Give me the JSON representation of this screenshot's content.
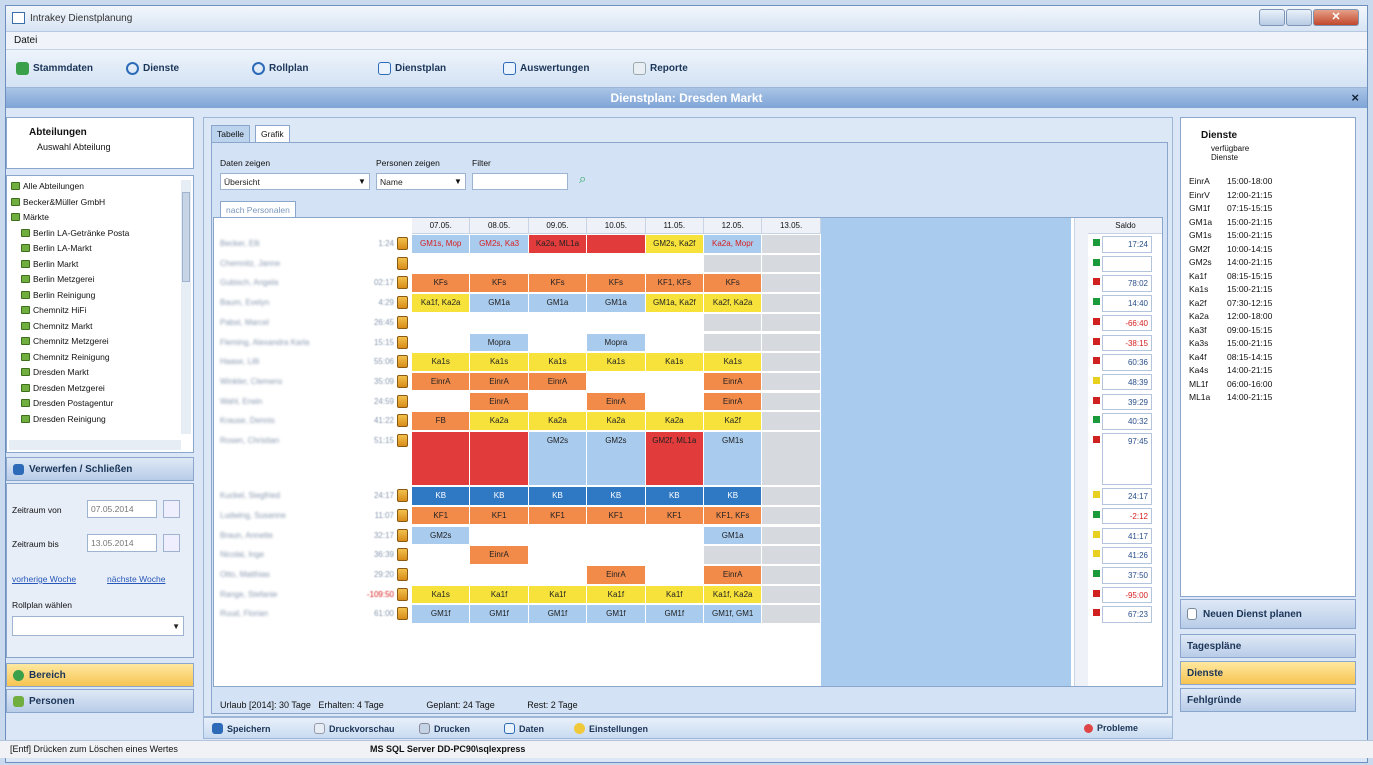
{
  "window": {
    "title": "Intrakey Dienstplanung"
  },
  "menu": {
    "file": "Datei"
  },
  "toolbar": {
    "stammdaten": "Stammdaten",
    "dienste": "Dienste",
    "rollplan": "Rollplan",
    "dienstplan": "Dienstplan",
    "auswertungen": "Auswertungen",
    "reporte": "Reporte"
  },
  "banner": {
    "title": "Dienstplan: Dresden Markt",
    "close": "×"
  },
  "left": {
    "abteilungen": "Abteilungen",
    "auswahl": "Auswahl Abteilung",
    "tree": [
      "Alle Abteilungen",
      "Becker&Müller GmbH",
      "Märkte",
      "Berlin LA-Getränke Posta",
      "Berlin LA-Markt",
      "Berlin Markt",
      "Berlin Metzgerei",
      "Berlin Reinigung",
      "Chemnitz HiFi",
      "Chemnitz Markt",
      "Chemnitz Metzgerei",
      "Chemnitz Reinigung",
      "Dresden Markt",
      "Dresden Metzgerei",
      "Dresden Postagentur",
      "Dresden Reinigung"
    ],
    "verwerfen": "Verwerfen / Schließen",
    "von_label": "Zeitraum von",
    "von_value": "07.05.2014",
    "bis_label": "Zeitraum bis",
    "bis_value": "13.05.2014",
    "prev_week": "vorherige Woche",
    "next_week": "nächste Woche",
    "rollplan_label": "Rollplan wählen",
    "bereich": "Bereich",
    "personen": "Personen"
  },
  "center": {
    "tab_tabelle": "Tabelle",
    "tab_grafik": "Grafik",
    "daten_label": "Daten zeigen",
    "daten_value": "Übersicht",
    "personen_label": "Personen zeigen",
    "personen_value": "Name",
    "filter_label": "Filter",
    "subtab": "nach Personalen",
    "dates": [
      "07.05.",
      "08.05.",
      "09.05.",
      "10.05.",
      "11.05.",
      "12.05.",
      "13.05."
    ],
    "saldo_header": "Saldo",
    "rows": [
      {
        "name": "Becker, Elli",
        "hours": "1:24",
        "cells": [
          [
            "GM1s, Mop",
            "r"
          ],
          [
            "GM2s, Ka3",
            "r"
          ],
          [
            "Ka2a, ML1a",
            "red"
          ],
          [
            "",
            "red"
          ],
          [
            "GM2s, Ka2f",
            "y"
          ],
          [
            "Ka2a, Mopr",
            "r"
          ]
        ],
        "saldo": "17:24",
        "sq": "#1a9a3a"
      },
      {
        "name": "Chemnitz, Janne",
        "hours": "",
        "cells": [
          [
            "",
            "w"
          ],
          [
            "",
            "w"
          ],
          [
            "",
            "w"
          ],
          [
            "",
            "w"
          ],
          [
            "",
            "w"
          ],
          [
            "",
            "g"
          ]
        ],
        "saldo": "",
        "sq": "#1a9a3a"
      },
      {
        "name": "Gubisch, Angela",
        "hours": "02:17",
        "cells": [
          [
            "KFs",
            "o"
          ],
          [
            "KFs",
            "o"
          ],
          [
            "KFs",
            "o"
          ],
          [
            "KFs",
            "o"
          ],
          [
            "KF1, KFs",
            "o"
          ],
          [
            "KFs",
            "o"
          ]
        ],
        "saldo": "78:02",
        "sq": "#d02020"
      },
      {
        "name": "Baum, Evelyn",
        "hours": "4:29",
        "cells": [
          [
            "Ka1f, Ka2a",
            "y"
          ],
          [
            "GM1a",
            "b"
          ],
          [
            "GM1a",
            "b"
          ],
          [
            "GM1a",
            "b"
          ],
          [
            "GM1a, Ka2f",
            "y"
          ],
          [
            "Ka2f, Ka2a",
            "y"
          ]
        ],
        "saldo": "14:40",
        "sq": "#1a9a3a"
      },
      {
        "name": "Pabst, Marcel",
        "hours": "26:45",
        "cells": [
          [
            "",
            "w"
          ],
          [
            "",
            "w"
          ],
          [
            "",
            "w"
          ],
          [
            "",
            "w"
          ],
          [
            "",
            "w"
          ],
          [
            "",
            "g"
          ]
        ],
        "saldo": "-66:40",
        "sq": "#d02020"
      },
      {
        "name": "Fleming, Alexandra Karla",
        "hours": "15:15",
        "cells": [
          [
            "",
            "w"
          ],
          [
            "Mopra",
            "b"
          ],
          [
            "",
            "w"
          ],
          [
            "Mopra",
            "b"
          ],
          [
            "",
            "w"
          ],
          [
            "",
            "g"
          ]
        ],
        "saldo": "-38:15",
        "sq": "#d02020"
      },
      {
        "name": "Haase, Lilli",
        "hours": "55:06",
        "cells": [
          [
            "Ka1s",
            "y"
          ],
          [
            "Ka1s",
            "y"
          ],
          [
            "Ka1s",
            "y"
          ],
          [
            "Ka1s",
            "y"
          ],
          [
            "Ka1s",
            "y"
          ],
          [
            "Ka1s",
            "y"
          ]
        ],
        "saldo": "60:36",
        "sq": "#d02020"
      },
      {
        "name": "Winkler, Clemens",
        "hours": "35:09",
        "cells": [
          [
            "EinrA",
            "o"
          ],
          [
            "EinrA",
            "o"
          ],
          [
            "EinrA",
            "o"
          ],
          [
            "",
            "w"
          ],
          [
            "",
            "w"
          ],
          [
            "EinrA",
            "o"
          ]
        ],
        "saldo": "48:39",
        "sq": "#e8d020"
      },
      {
        "name": "Wahl, Erwin",
        "hours": "24:59",
        "cells": [
          [
            "",
            "w"
          ],
          [
            "EinrA",
            "o"
          ],
          [
            "",
            "w"
          ],
          [
            "EinrA",
            "o"
          ],
          [
            "",
            "w"
          ],
          [
            "EinrA",
            "o"
          ]
        ],
        "saldo": "39:29",
        "sq": "#d02020"
      },
      {
        "name": "Krause, Dennis",
        "hours": "41:22",
        "cells": [
          [
            "FB",
            "o"
          ],
          [
            "Ka2a",
            "y"
          ],
          [
            "Ka2a",
            "y"
          ],
          [
            "Ka2a",
            "y"
          ],
          [
            "Ka2a",
            "y"
          ],
          [
            "Ka2f",
            "y"
          ]
        ],
        "saldo": "40:32",
        "sq": "#1a9a3a"
      },
      {
        "name": "Rosen, Christian",
        "hours": "51:15",
        "cells": [
          [
            "",
            "red"
          ],
          [
            "",
            "red"
          ],
          [
            "GM2s",
            "b"
          ],
          [
            "GM2s",
            "b"
          ],
          [
            "GM2f, ML1a",
            "red"
          ],
          [
            "GM1s",
            "b"
          ]
        ],
        "saldo": "97:45",
        "sq": "#d02020",
        "tall": true
      },
      {
        "name": "Kuckel, Siegfried",
        "hours": "24:17",
        "cells": [
          [
            "KB",
            "db"
          ],
          [
            "KB",
            "db"
          ],
          [
            "KB",
            "db"
          ],
          [
            "KB",
            "db"
          ],
          [
            "KB",
            "db"
          ],
          [
            "KB",
            "db"
          ]
        ],
        "saldo": "24:17",
        "sq": "#e8d020"
      },
      {
        "name": "Ludwing, Susanne",
        "hours": "11:07",
        "cells": [
          [
            "KF1",
            "o"
          ],
          [
            "KF1",
            "o"
          ],
          [
            "KF1",
            "o"
          ],
          [
            "KF1",
            "o"
          ],
          [
            "KF1",
            "o"
          ],
          [
            "KF1, KFs",
            "o"
          ]
        ],
        "saldo": "-2:12",
        "sq": "#1a9a3a"
      },
      {
        "name": "Braun, Annette",
        "hours": "32:17",
        "cells": [
          [
            "GM2s",
            "b"
          ],
          [
            "",
            "w"
          ],
          [
            "",
            "w"
          ],
          [
            "",
            "w"
          ],
          [
            "",
            "w"
          ],
          [
            "GM1a",
            "b"
          ]
        ],
        "saldo": "41:17",
        "sq": "#e8d020"
      },
      {
        "name": "Nicolai, Inge",
        "hours": "36:39",
        "cells": [
          [
            "",
            "w"
          ],
          [
            "EinrA",
            "o"
          ],
          [
            "",
            "w"
          ],
          [
            "",
            "w"
          ],
          [
            "",
            "w"
          ],
          [
            "",
            "g"
          ]
        ],
        "saldo": "41:26",
        "sq": "#e8d020"
      },
      {
        "name": "Otto, Matthias",
        "hours": "29:20",
        "cells": [
          [
            "",
            "w"
          ],
          [
            "",
            "w"
          ],
          [
            "",
            "w"
          ],
          [
            "EinrA",
            "o"
          ],
          [
            "",
            "w"
          ],
          [
            "EinrA",
            "o"
          ]
        ],
        "saldo": "37:50",
        "sq": "#1a9a3a"
      },
      {
        "name": "Range, Stefanie",
        "hours": "-109:50",
        "cells": [
          [
            "Ka1s",
            "y"
          ],
          [
            "Ka1f",
            "y"
          ],
          [
            "Ka1f",
            "y"
          ],
          [
            "Ka1f",
            "y"
          ],
          [
            "Ka1f",
            "y"
          ],
          [
            "Ka1f, Ka2a",
            "y"
          ]
        ],
        "saldo": "-95:00",
        "sq": "#d02020"
      },
      {
        "name": "Ruud, Florian",
        "hours": "61:00",
        "cells": [
          [
            "GM1f",
            "b"
          ],
          [
            "GM1f",
            "b"
          ],
          [
            "GM1f",
            "b"
          ],
          [
            "GM1f",
            "b"
          ],
          [
            "GM1f",
            "b"
          ],
          [
            "GM1f, GM1",
            "b"
          ]
        ],
        "saldo": "67:23",
        "sq": "#d02020"
      }
    ],
    "summary": {
      "urlaub": "Urlaub [2014]: 30 Tage",
      "erhalten": "Erhalten: 4 Tage",
      "geplant": "Geplant: 24 Tage",
      "rest": "Rest: 2 Tage"
    }
  },
  "right": {
    "title": "Dienste",
    "sub1": "verfügbare",
    "sub2": "Dienste",
    "services": [
      [
        "EinrA",
        "15:00-18:00"
      ],
      [
        "EinrV",
        "12:00-21:15"
      ],
      [
        "GM1f",
        "07:15-15:15"
      ],
      [
        "GM1a",
        "15:00-21:15"
      ],
      [
        "GM1s",
        "15:00-21:15"
      ],
      [
        "GM2f",
        "10:00-14:15"
      ],
      [
        "GM2s",
        "14:00-21:15"
      ],
      [
        "Ka1f",
        "08:15-15:15"
      ],
      [
        "Ka1s",
        "15:00-21:15"
      ],
      [
        "Ka2f",
        "07:30-12:15"
      ],
      [
        "Ka2a",
        "12:00-18:00"
      ],
      [
        "Ka3f",
        "09:00-15:15"
      ],
      [
        "Ka3s",
        "15:00-21:15"
      ],
      [
        "Ka4f",
        "08:15-14:15"
      ],
      [
        "Ka4s",
        "14:00-21:15"
      ],
      [
        "ML1f",
        "06:00-16:00"
      ],
      [
        "ML1a",
        "14:00-21:15"
      ]
    ],
    "neuen": "Neuen Dienst planen",
    "tagesplaene": "Tagespläne",
    "dienste": "Dienste",
    "fehlgruende": "Fehlgründe"
  },
  "bottombar": {
    "speichern": "Speichern",
    "druckvorschau": "Druckvorschau",
    "drucken": "Drucken",
    "daten": "Daten",
    "einstellungen": "Einstellungen",
    "probleme": "Probleme"
  },
  "status": {
    "hint": "[Entf] Drücken zum Löschen eines Wertes",
    "server": "MS SQL Server DD-PC90\\sqlexpress"
  },
  "colors": {
    "red": "#e23b3b",
    "orange": "#f28a4a",
    "yellow": "#f6e23a",
    "blue": "#a9cbee",
    "darkblue": "#2f78c4",
    "gray": "#d6d9de"
  }
}
